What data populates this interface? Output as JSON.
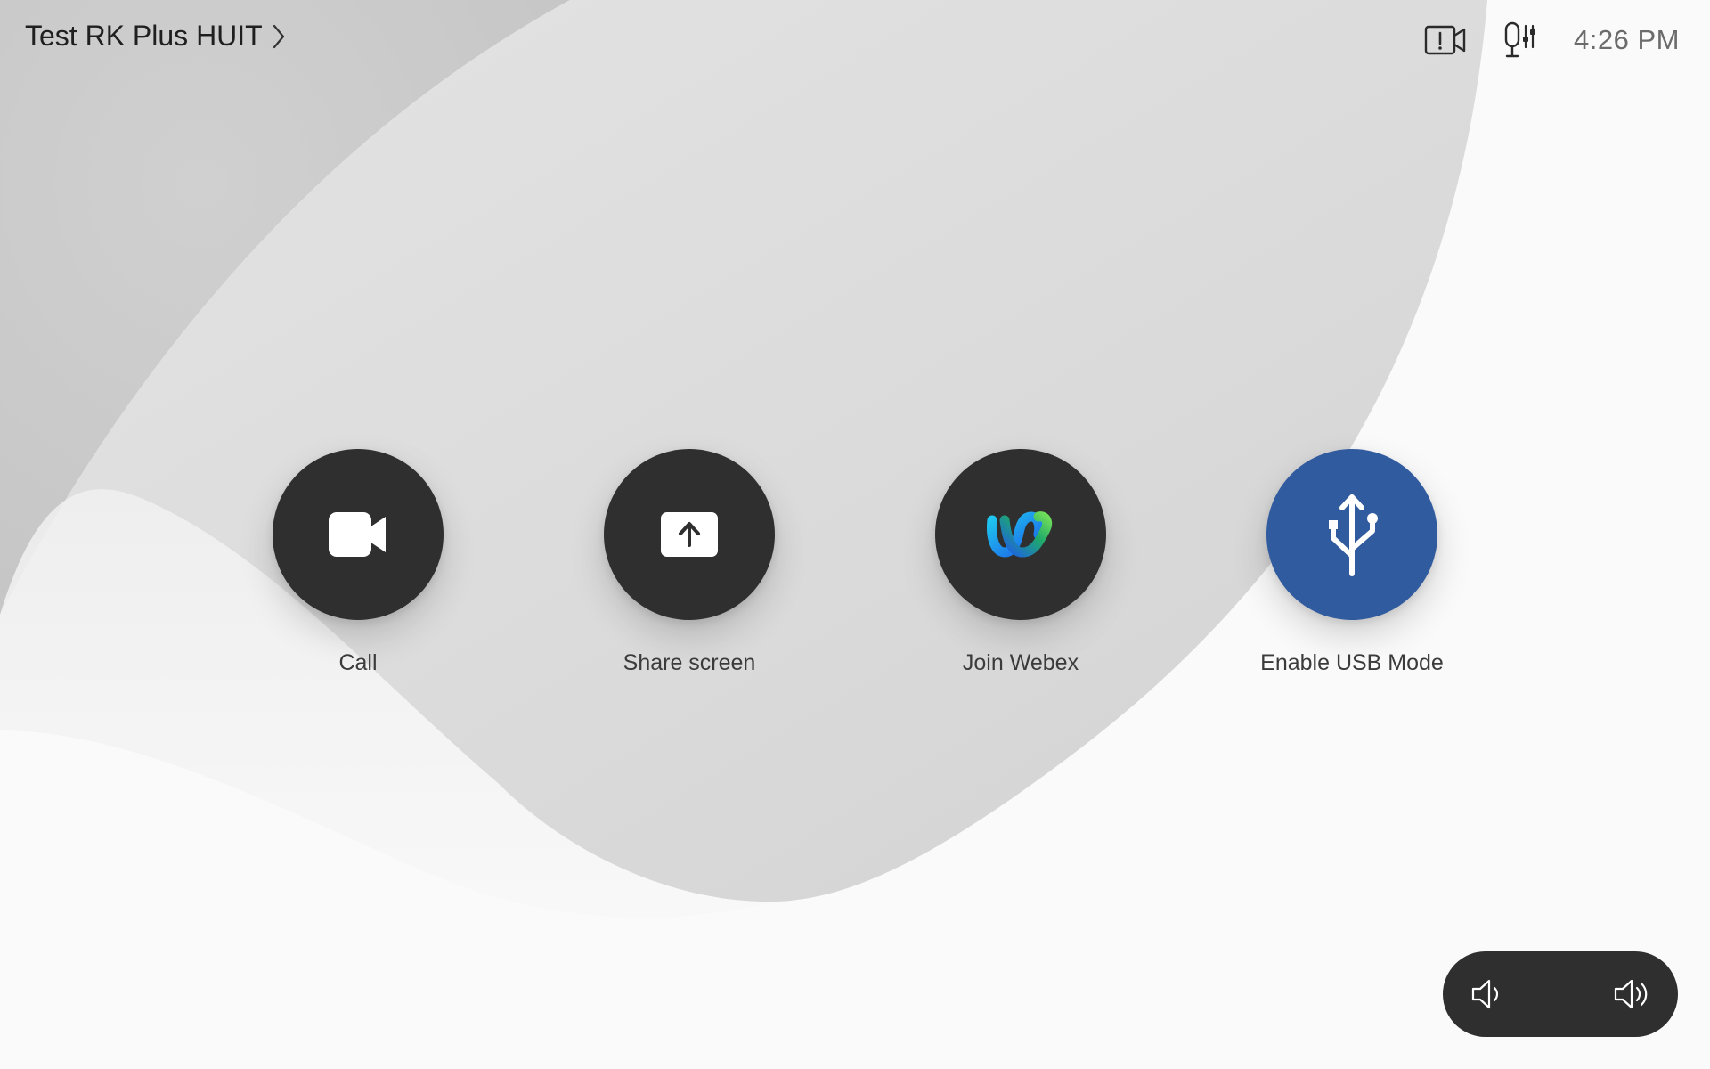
{
  "header": {
    "room_name": "Test RK Plus HUIT",
    "time": "4:26 PM"
  },
  "status_icons": [
    "camera-alert-icon",
    "microphone-settings-icon"
  ],
  "actions": [
    {
      "label": "Call",
      "icon": "video-camera-icon",
      "color": "#2f2f2f"
    },
    {
      "label": "Share screen",
      "icon": "share-screen-icon",
      "color": "#2f2f2f"
    },
    {
      "label": "Join Webex",
      "icon": "webex-logo-icon",
      "color": "#2f2f2f"
    },
    {
      "label": "Enable USB Mode",
      "icon": "usb-icon",
      "color": "#315b9f"
    }
  ],
  "volume": {
    "down_icon": "volume-down-icon",
    "up_icon": "volume-up-icon"
  },
  "colors": {
    "button_dark": "#2f2f2f",
    "usb_blue": "#315b9f",
    "background": "#fafafa"
  }
}
